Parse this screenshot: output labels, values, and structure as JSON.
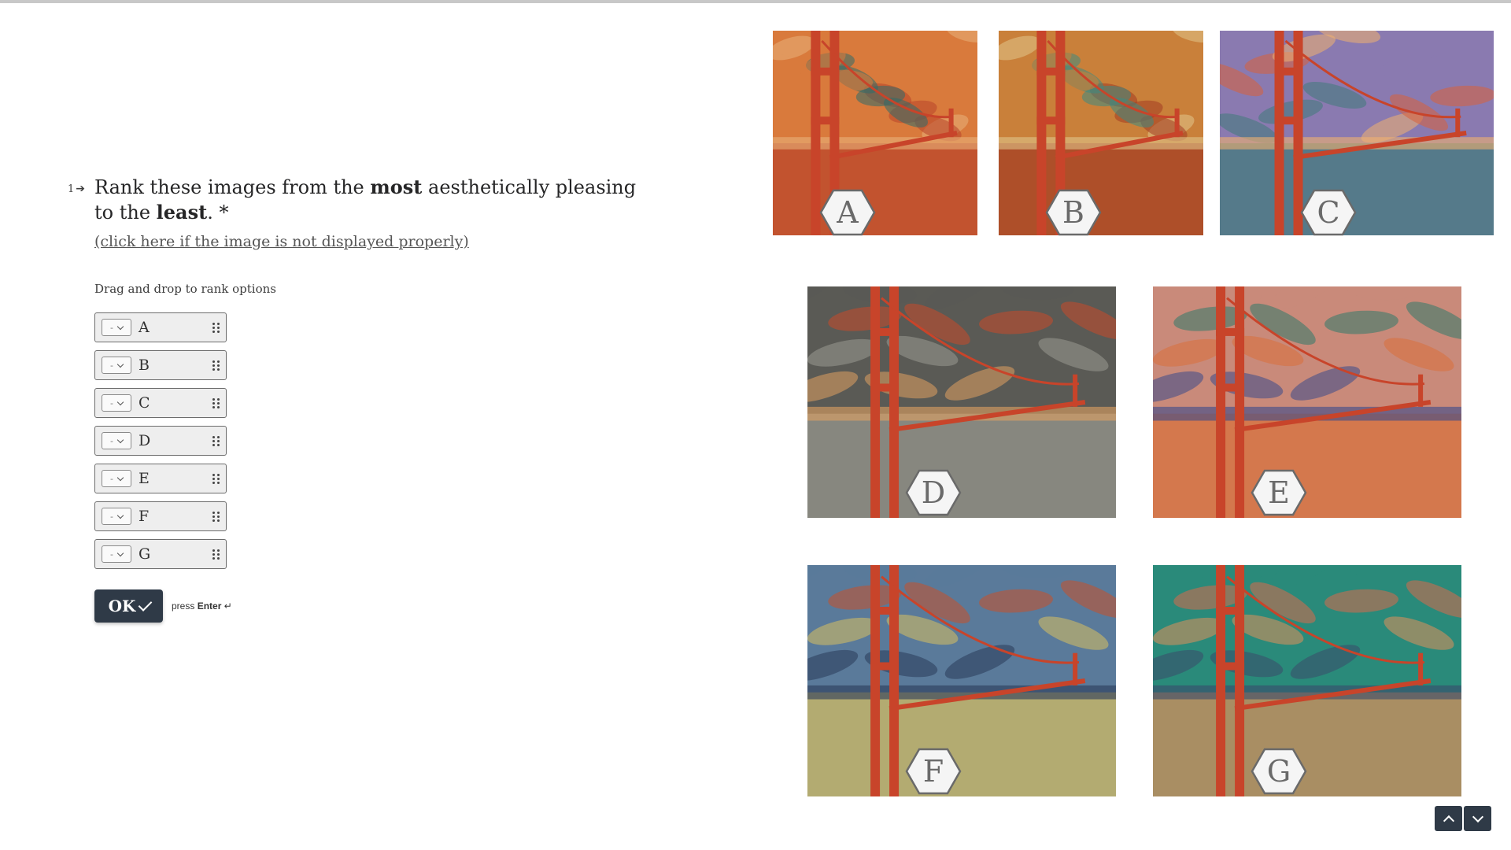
{
  "question": {
    "number": "1",
    "title_part1": "Rank these images from the ",
    "title_bold1": "most",
    "title_part2": " aesthetically pleasing to the ",
    "title_bold2": "least",
    "title_part3": ". *",
    "image_link": "(click here if the image is not displayed properly)",
    "hint": "Drag and drop to rank options"
  },
  "rank_options": [
    {
      "select_value": "-",
      "label": "A"
    },
    {
      "select_value": "-",
      "label": "B"
    },
    {
      "select_value": "-",
      "label": "C"
    },
    {
      "select_value": "-",
      "label": "D"
    },
    {
      "select_value": "-",
      "label": "E"
    },
    {
      "select_value": "-",
      "label": "F"
    },
    {
      "select_value": "-",
      "label": "G"
    }
  ],
  "ok_button": {
    "label": "OK"
  },
  "press_enter": {
    "prefix": "press ",
    "key": "Enter",
    "symbol": "↵"
  },
  "images": [
    {
      "label": "A",
      "style": "bridge-painting",
      "palette": [
        "#d97a3c",
        "#2f6b6a",
        "#b8432a",
        "#e8b07a"
      ]
    },
    {
      "label": "B",
      "style": "bridge-painting",
      "palette": [
        "#c9803a",
        "#3d8a82",
        "#a23b22",
        "#e0c48a"
      ]
    },
    {
      "label": "C",
      "style": "bridge-painting",
      "palette": [
        "#8a7ab0",
        "#d8603a",
        "#3f7a7a",
        "#f0b070"
      ]
    },
    {
      "label": "D",
      "style": "bridge-painting",
      "palette": [
        "#5a5a55",
        "#c84a2a",
        "#9a9a92",
        "#e0a060"
      ]
    },
    {
      "label": "E",
      "style": "bridge-painting",
      "palette": [
        "#c98a7a",
        "#2f7a6a",
        "#d8703a",
        "#3a4a8a"
      ]
    },
    {
      "label": "F",
      "style": "bridge-painting",
      "palette": [
        "#5a7a9a",
        "#c8502a",
        "#d8c060",
        "#2a3a5a"
      ]
    },
    {
      "label": "G",
      "style": "bridge-painting",
      "palette": [
        "#2a8a7a",
        "#d86a4a",
        "#e0905a",
        "#3a4a6a"
      ]
    }
  ],
  "colors": {
    "accent": "#2f3a47",
    "rank_item_bg": "#eeeeee",
    "bridge": "#c8442a"
  }
}
